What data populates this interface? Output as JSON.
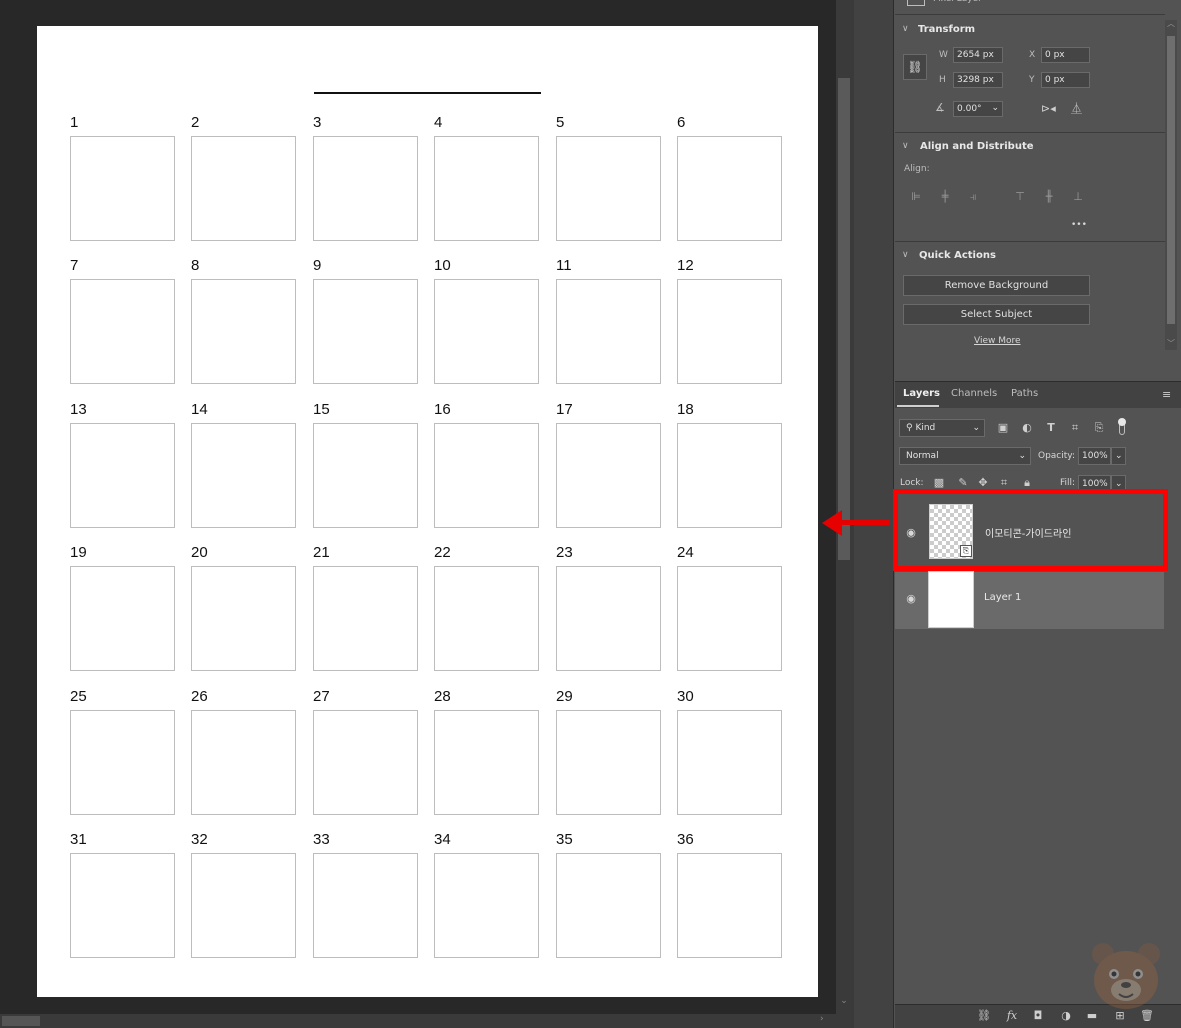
{
  "grid": {
    "numbers": [
      "1",
      "2",
      "3",
      "4",
      "5",
      "6",
      "7",
      "8",
      "9",
      "10",
      "11",
      "12",
      "13",
      "14",
      "15",
      "16",
      "17",
      "18",
      "19",
      "20",
      "21",
      "22",
      "23",
      "24",
      "25",
      "26",
      "27",
      "28",
      "29",
      "30",
      "31",
      "32",
      "33",
      "34",
      "35",
      "36"
    ]
  },
  "properties": {
    "top_layer_type": "Pixel Layer",
    "transform": {
      "title": "Transform",
      "w_label": "W",
      "w_value": "2654 px",
      "h_label": "H",
      "h_value": "3298 px",
      "x_label": "X",
      "x_value": "0 px",
      "y_label": "Y",
      "y_value": "0 px",
      "angle_value": "0.00°"
    },
    "align": {
      "title": "Align and Distribute",
      "align_label": "Align:",
      "more_glyph": "•••"
    },
    "quick_actions": {
      "title": "Quick Actions",
      "remove_bg": "Remove Background",
      "select_subject": "Select Subject",
      "view_more": "View More"
    }
  },
  "layers_panel": {
    "tabs": [
      "Layers",
      "Channels",
      "Paths"
    ],
    "active_tab": "Layers",
    "filter_kind": "Kind",
    "blend_mode": "Normal",
    "opacity_label": "Opacity:",
    "opacity_value": "100%",
    "lock_label": "Lock:",
    "fill_label": "Fill:",
    "fill_value": "100%",
    "layers": [
      {
        "name": "이모티콘-가이드라인",
        "visible": true,
        "thumbnail": "transparent-checker"
      },
      {
        "name": "Layer 1",
        "visible": true,
        "thumbnail": "white"
      }
    ]
  },
  "colors": {
    "highlight": "#ff0000",
    "panel_bg": "#535353",
    "workspace_bg": "#282828"
  }
}
